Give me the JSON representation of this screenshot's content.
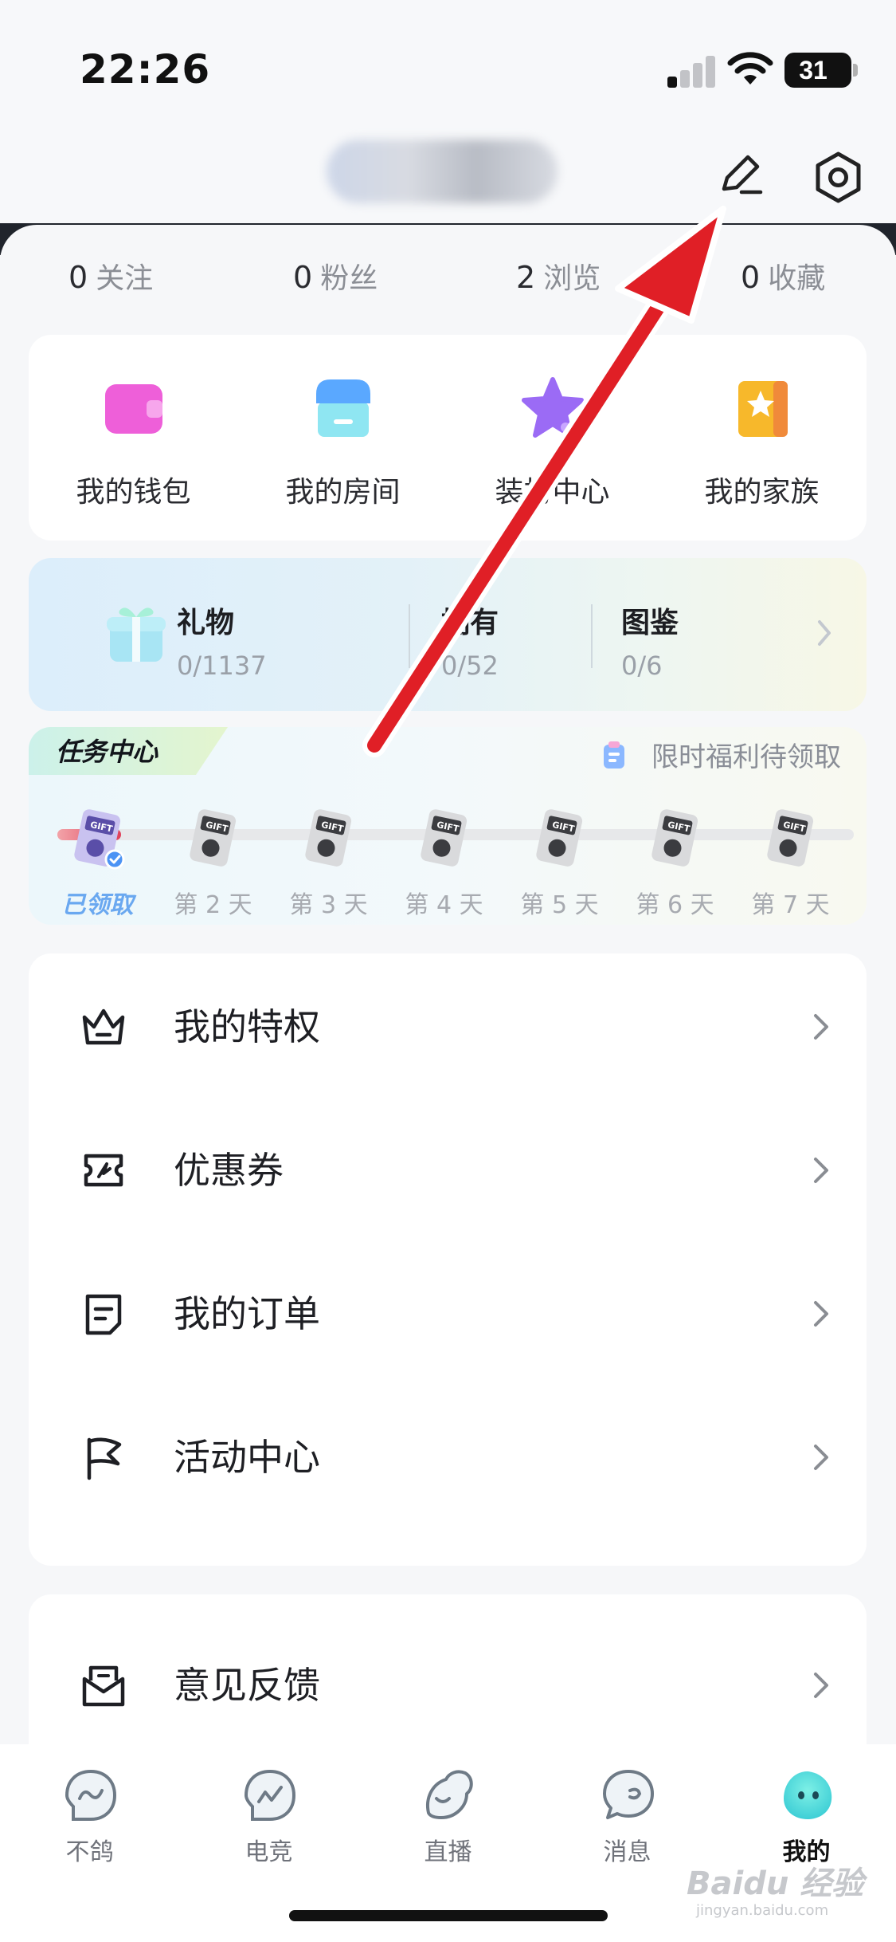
{
  "status_bar": {
    "time": "22:26",
    "battery": "31"
  },
  "header": {
    "edit_icon": "pencil-icon",
    "settings_icon": "settings-hexagon-icon"
  },
  "stats": [
    {
      "num": "0",
      "label": "关注"
    },
    {
      "num": "0",
      "label": "粉丝"
    },
    {
      "num": "2",
      "label": "浏览"
    },
    {
      "num": "0",
      "label": "收藏"
    }
  ],
  "quick_actions": [
    {
      "label": "我的钱包",
      "icon": "wallet-icon",
      "color": "#ee5fd9"
    },
    {
      "label": "我的房间",
      "icon": "shop-icon",
      "color": "#5aa8ff"
    },
    {
      "label": "装扮中心",
      "icon": "star-icon",
      "color": "#9b6bf5"
    },
    {
      "label": "我的家族",
      "icon": "family-book-icon",
      "color": "#f7b82b"
    }
  ],
  "collection": {
    "items": [
      {
        "title": "礼物",
        "count": "0/1137"
      },
      {
        "title": "拥有",
        "count": "0/52"
      },
      {
        "title": "图鉴",
        "count": "0/6"
      }
    ]
  },
  "task_center": {
    "title": "任务中心",
    "promo": "限时福利待领取",
    "progress": 0.14,
    "days": [
      {
        "label": "已领取",
        "claimed": true
      },
      {
        "label": "第 2 天",
        "claimed": false
      },
      {
        "label": "第 3 天",
        "claimed": false
      },
      {
        "label": "第 4 天",
        "claimed": false
      },
      {
        "label": "第 5 天",
        "claimed": false
      },
      {
        "label": "第 6 天",
        "claimed": false
      },
      {
        "label": "第 7 天",
        "claimed": false
      }
    ]
  },
  "menu": [
    {
      "label": "我的特权",
      "icon": "crown-icon"
    },
    {
      "label": "优惠券",
      "icon": "coupon-icon"
    },
    {
      "label": "我的订单",
      "icon": "order-icon"
    },
    {
      "label": "活动中心",
      "icon": "flag-icon"
    }
  ],
  "menu2": [
    {
      "label": "意见反馈",
      "icon": "feedback-mail-icon"
    }
  ],
  "tabbar": [
    {
      "label": "不鸽",
      "active": false
    },
    {
      "label": "电竞",
      "active": false
    },
    {
      "label": "直播",
      "active": false
    },
    {
      "label": "消息",
      "active": false
    },
    {
      "label": "我的",
      "active": true
    }
  ],
  "watermark": {
    "brand": "Baidu 经验",
    "url": "jingyan.baidu.com"
  },
  "annotation": {
    "arrow_color": "#e01f26"
  }
}
